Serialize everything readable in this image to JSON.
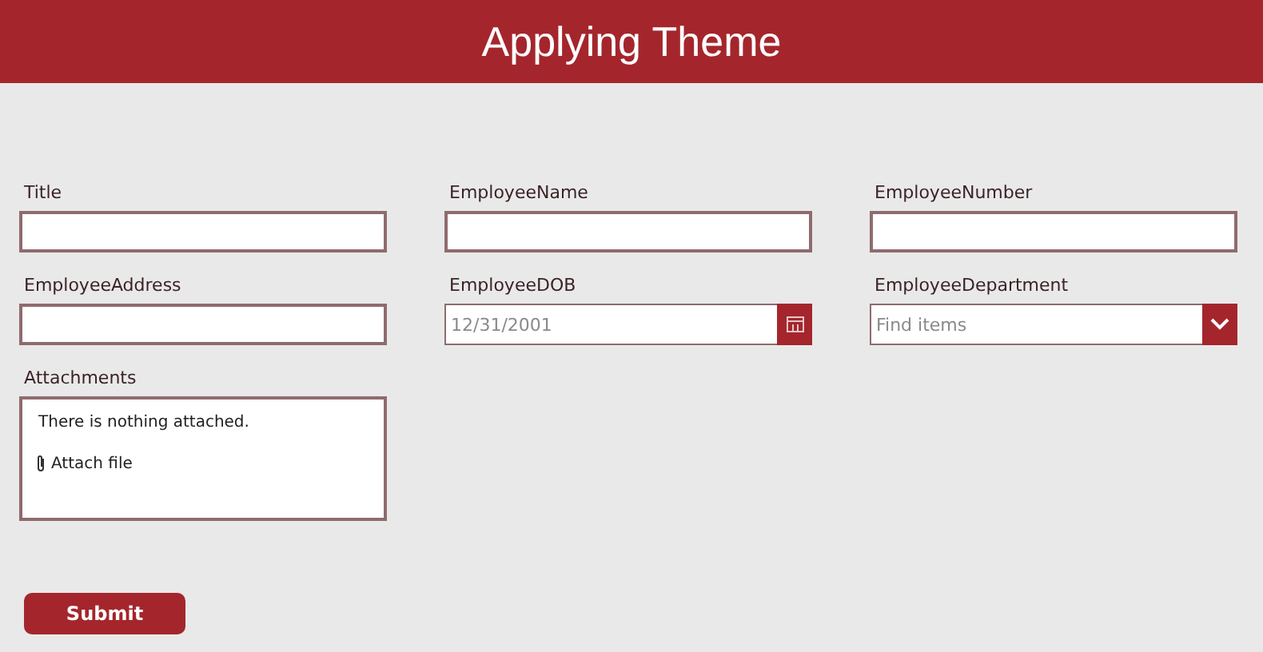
{
  "header": {
    "title": "Applying Theme"
  },
  "fields": [
    {
      "kind": "text",
      "label": "Title"
    },
    {
      "kind": "text",
      "label": "EmployeeName"
    },
    {
      "kind": "text",
      "label": "EmployeeNumber"
    },
    {
      "kind": "text",
      "label": "EmployeeAddress"
    },
    {
      "kind": "date",
      "label": "EmployeeDOB",
      "placeholder": "12/31/2001"
    },
    {
      "kind": "dropdown",
      "label": "EmployeeDepartment",
      "placeholder": "Find items"
    },
    {
      "kind": "attachments",
      "label": "Attachments",
      "message": "There is nothing attached.",
      "action": "Attach file"
    }
  ],
  "submit": {
    "label": "Submit"
  }
}
